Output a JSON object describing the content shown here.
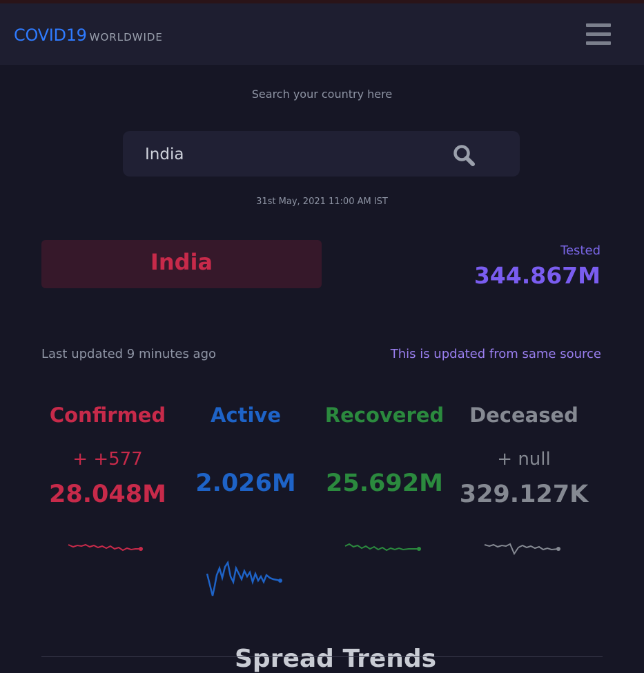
{
  "header": {
    "brand": "COVID19",
    "brand_sub": "WORLDWIDE"
  },
  "search": {
    "hint": "Search your country here",
    "value": "India",
    "icon": "search-icon"
  },
  "timestamp": "31st May, 2021 11:00 AM IST",
  "country": {
    "name": "India",
    "tested_label": "Tested",
    "tested_value": "344.867M"
  },
  "updates": {
    "last_updated": "Last updated 9 minutes ago",
    "source_note": "This is updated from same source"
  },
  "stats": {
    "confirmed": {
      "label": "Confirmed",
      "delta": "+ +577",
      "value": "28.048M",
      "color": "#c72a4a"
    },
    "active": {
      "label": "Active",
      "value": "2.026M",
      "color": "#1e63c7"
    },
    "recovered": {
      "label": "Recovered",
      "value": "25.692M",
      "color": "#2b8a3e"
    },
    "deceased": {
      "label": "Deceased",
      "delta": "+ null",
      "value": "329.127K",
      "color": "#858992"
    }
  },
  "section": {
    "heading": "Spread Trends"
  },
  "colors": {
    "background": "#161625",
    "navbar": "#1e1e30",
    "accent": "#2f7bff",
    "tested": "#7a5df0"
  }
}
